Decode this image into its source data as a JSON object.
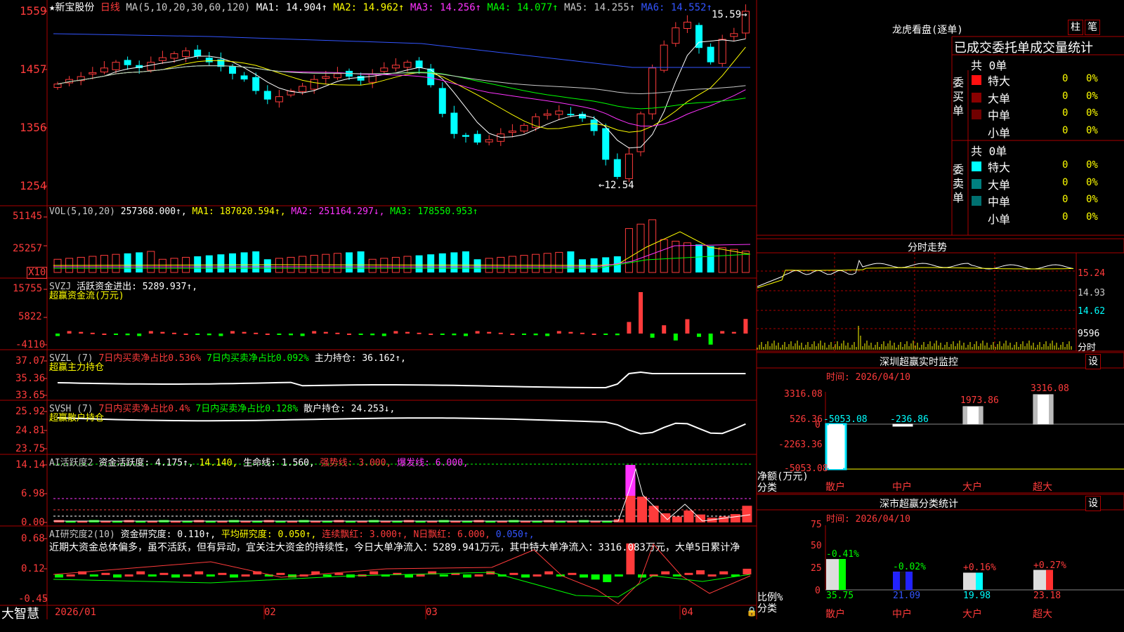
{
  "colors": {
    "up": "#ff3b3b",
    "down": "#00ffff",
    "grid": "#aa0000",
    "ma1": "#ffffff",
    "ma2": "#ffff00",
    "ma3": "#ff33ff",
    "ma4": "#00ff00",
    "ma5": "#c8c8c8",
    "ma6": "#3355ff"
  },
  "header": {
    "star_icon": "star-icon",
    "stock_name": "★新宝股份",
    "period": "日线",
    "ma_params": "MA(5,10,20,30,60,120)",
    "ma1": "MA1: 14.904↑",
    "ma2": "MA2: 14.962↑",
    "ma3": "MA3: 14.256↑",
    "ma4": "MA4: 14.077↑",
    "ma5": "MA5: 14.255↑",
    "ma6": "MA6: 14.552↑",
    "high_mark": "15.59",
    "low_mark": "12.54"
  },
  "price_axis": [
    "1559",
    "1457",
    "1356",
    "1254"
  ],
  "vol": {
    "label": "VOL(5,10,20)",
    "value": "257368.000↑,",
    "ma1": "MA1: 187020.594↑,",
    "ma2": "MA2: 251164.297↓,",
    "ma3": "MA3: 178550.953↑",
    "axis": [
      "51145",
      "25257"
    ],
    "unit": "X10"
  },
  "svzj": {
    "label": "SVZJ",
    "text": "活跃资金进出: 5289.937↑,",
    "title": "超赢资金流(万元)",
    "axis": [
      "15755",
      "5822",
      "-4110"
    ]
  },
  "svzl": {
    "label": "SVZL (7)",
    "t1": "7日内买卖净占比0.536%",
    "t2": "7日内买卖净占比0.092%",
    "t3": "主力持仓: 36.162↑,",
    "title": "超赢主力持仓",
    "axis": [
      "37.07",
      "35.36",
      "33.65"
    ]
  },
  "svsh": {
    "label": "SVSH (7)",
    "t1": "7日内买卖净占比0.4%",
    "t2": "7日内买卖净占比0.128%",
    "t3": "散户持仓: 24.253↓,",
    "title": "超赢散户持仓",
    "axis": [
      "25.92",
      "24.81",
      "23.75"
    ]
  },
  "ai1": {
    "label": "AI活跃度2",
    "t1": "资金活跃度: 4.175↑,",
    "t2": "14.140,",
    "t3": "生命线: 1.560,",
    "t4": "强势线: 3.000,",
    "t5": "爆发线: 6.000,",
    "axis": [
      "14.14",
      "6.98",
      "0.00"
    ]
  },
  "ai2": {
    "label": "AI研究度2(10)",
    "t1": "资金研究度: 0.110↑,",
    "t2": "平均研究度: 0.050↑,",
    "t3": "连续飘红: 3.000↑,",
    "t4": "N日飘红: 6.000,",
    "t5": "0.050↑,",
    "note": "近期大资金总体偏多，虽不活跃，但有异动，宜关注大资金的持续性，今日大单净流入：5289.941万元，其中特大单净流入：3316.083万元，大单5日累计净",
    "axis": [
      "0.68",
      "0.12",
      "-0.45"
    ]
  },
  "dates": [
    "2026/01",
    "02",
    "03",
    "04"
  ],
  "logo": "大智慧",
  "lhb": {
    "title": "龙虎看盘(逐单)",
    "btn1": "柱",
    "btn2": "笔",
    "tabs": [
      "已成交委托单",
      "成交量统计"
    ],
    "buy_total": "共 0单",
    "buy_label": "委买单",
    "sell_total": "共 0单",
    "sell_label": "委卖单",
    "rows": [
      {
        "name": "特大",
        "val": "0",
        "pct": "0%"
      },
      {
        "name": "大单",
        "val": "0",
        "pct": "0%"
      },
      {
        "name": "中单",
        "val": "0",
        "pct": "0%"
      },
      {
        "name": "小单",
        "val": "0",
        "pct": "0%"
      }
    ]
  },
  "fenshi": {
    "title": "分时走势",
    "axis": [
      "15.24",
      "14.93",
      "14.62",
      "9596"
    ],
    "unit": "分时"
  },
  "monitor": {
    "title": "深圳超赢实时监控",
    "settings": "设",
    "time": "时间: 2026/04/10",
    "axis": [
      "3316.08",
      "526.36",
      "0",
      "-2263.36",
      "-5053.08"
    ],
    "ylabel1": "净额(万元)",
    "ylabel2": "分类",
    "values": [
      -5053.08,
      -236.86,
      1973.86,
      3316.08
    ],
    "value_labels": [
      "-5053.08",
      "-236.86",
      "1973.86",
      "3316.08"
    ],
    "categories": [
      "散户",
      "中户",
      "大户",
      "超大"
    ]
  },
  "classify": {
    "title": "深市超赢分类统计",
    "settings": "设",
    "time": "时间: 2026/04/10",
    "axis": [
      "75",
      "50",
      "25",
      "0"
    ],
    "ylabel1": "比例%",
    "ylabel2": "分类",
    "values": [
      35.75,
      21.09,
      19.98,
      23.18
    ],
    "changes": [
      "-0.41%",
      "-0.02%",
      "+0.16%",
      "+0.27%"
    ],
    "categories": [
      "散户",
      "中户",
      "大户",
      "超大"
    ]
  }
}
